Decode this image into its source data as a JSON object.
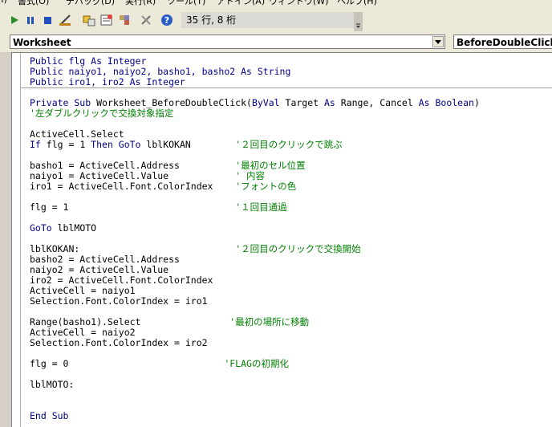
{
  "menu": [
    "(I)",
    "書式(O)",
    "デバッグ(D)",
    "実行(R)",
    "ツール(T)",
    "アドイン(A)",
    "ウィンドウ(W)",
    "ヘルプ(H)"
  ],
  "toolbar": {
    "buttons": [
      "run-icon",
      "pause-icon",
      "stop-icon",
      "design-mode-icon",
      "project-explorer-icon",
      "properties-icon",
      "object-browser-icon",
      "toolbox-icon",
      "help-icon"
    ],
    "cursor_position": "35 行, 8 桁"
  },
  "object_combo": "Worksheet",
  "procedure_combo": "BeforeDoubleClick",
  "code_lines": [
    [
      [
        "Public flg As Integer",
        "kw"
      ]
    ],
    [
      [
        "Public naiyo1, naiyo2, basho1, basho2 As String",
        "kw"
      ]
    ],
    [
      [
        "Public iro1, iro2 As Integer",
        "kw"
      ]
    ],
    [],
    [
      [
        "Private Sub ",
        "kw"
      ],
      [
        "Worksheet_BeforeDoubleClick(",
        ""
      ],
      [
        "ByVal ",
        "kw"
      ],
      [
        "Target ",
        ""
      ],
      [
        "As ",
        "kw"
      ],
      [
        "Range, Cancel ",
        ""
      ],
      [
        "As Boolean",
        "kw"
      ],
      [
        ")",
        ""
      ]
    ],
    [
      [
        "'左ダブルクリックで交換対象指定",
        "cm"
      ]
    ],
    [],
    [
      [
        "ActiveCell.Select",
        ""
      ]
    ],
    [
      [
        "If ",
        "kw"
      ],
      [
        "flg = 1 ",
        ""
      ],
      [
        "Then GoTo ",
        "kw"
      ],
      [
        "lblKOKAN        ",
        ""
      ],
      [
        "'２回目のクリックで跳ぶ",
        "cm"
      ]
    ],
    [],
    [
      [
        "basho1 = ActiveCell.Address          ",
        ""
      ],
      [
        "'最初のセル位置",
        "cm"
      ]
    ],
    [
      [
        "naiyo1 = ActiveCell.Value            ",
        ""
      ],
      [
        "' 内容",
        "cm"
      ]
    ],
    [
      [
        "iro1 = ActiveCell.Font.ColorIndex    ",
        ""
      ],
      [
        "'フォントの色",
        "cm"
      ]
    ],
    [],
    [
      [
        "flg = 1                              ",
        ""
      ],
      [
        "'１回目通過",
        "cm"
      ]
    ],
    [],
    [
      [
        "GoTo ",
        "kw"
      ],
      [
        "lblMOTO",
        ""
      ]
    ],
    [],
    [
      [
        "lblKOKAN:                            ",
        ""
      ],
      [
        "'２回目のクリックで交換開始",
        "cm"
      ]
    ],
    [
      [
        "basho2 = ActiveCell.Address",
        ""
      ]
    ],
    [
      [
        "naiyo2 = ActiveCell.Value",
        ""
      ]
    ],
    [
      [
        "iro2 = ActiveCell.Font.ColorIndex",
        ""
      ]
    ],
    [
      [
        "ActiveCell = naiyo1",
        ""
      ]
    ],
    [
      [
        "Selection.Font.ColorIndex = iro1",
        ""
      ]
    ],
    [],
    [
      [
        "Range(basho1).Select                ",
        ""
      ],
      [
        "'最初の場所に移動",
        "cm"
      ]
    ],
    [
      [
        "ActiveCell = naiyo2",
        ""
      ]
    ],
    [
      [
        "Selection.Font.ColorIndex = iro2",
        ""
      ]
    ],
    [],
    [
      [
        "flg = 0                            ",
        ""
      ],
      [
        "'FLAGの初期化",
        "cm"
      ]
    ],
    [],
    [
      [
        "lblMOTO:",
        ""
      ]
    ],
    [],
    [],
    [
      [
        "End Sub",
        "kw"
      ]
    ]
  ],
  "colors": {
    "keyword": "#00008b",
    "comment": "#008000",
    "text": "#000000"
  }
}
